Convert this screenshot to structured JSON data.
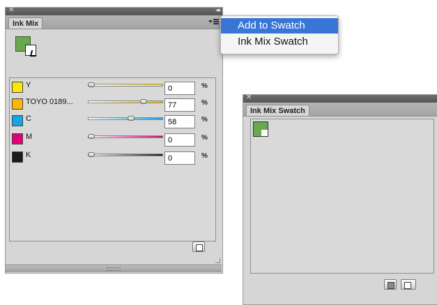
{
  "ink_mix_panel": {
    "tab_label": "Ink Mix",
    "rows": [
      {
        "name": "Y",
        "value": "0",
        "unit": "%",
        "color": "#ffe600",
        "level": 0.0
      },
      {
        "name": "TOYO 0189...",
        "value": "77",
        "unit": "%",
        "color": "#ffb400",
        "level": 0.77
      },
      {
        "name": "C",
        "value": "58",
        "unit": "%",
        "color": "#13a6e0",
        "level": 0.58
      },
      {
        "name": "M",
        "value": "0",
        "unit": "%",
        "color": "#e2007a",
        "level": 0.0
      },
      {
        "name": "K",
        "value": "0",
        "unit": "%",
        "color": "#1a1a1a",
        "level": 0.0
      }
    ]
  },
  "flyout_menu": {
    "items": [
      {
        "label": "Add to Swatch",
        "selected": true
      },
      {
        "label": "Ink Mix Swatch",
        "selected": false
      }
    ]
  },
  "swatch_panel": {
    "tab_label": "Ink Mix Swatch"
  },
  "colors": {
    "mix_green": "#6aa84f",
    "menu_highlight": "#3875d7"
  }
}
